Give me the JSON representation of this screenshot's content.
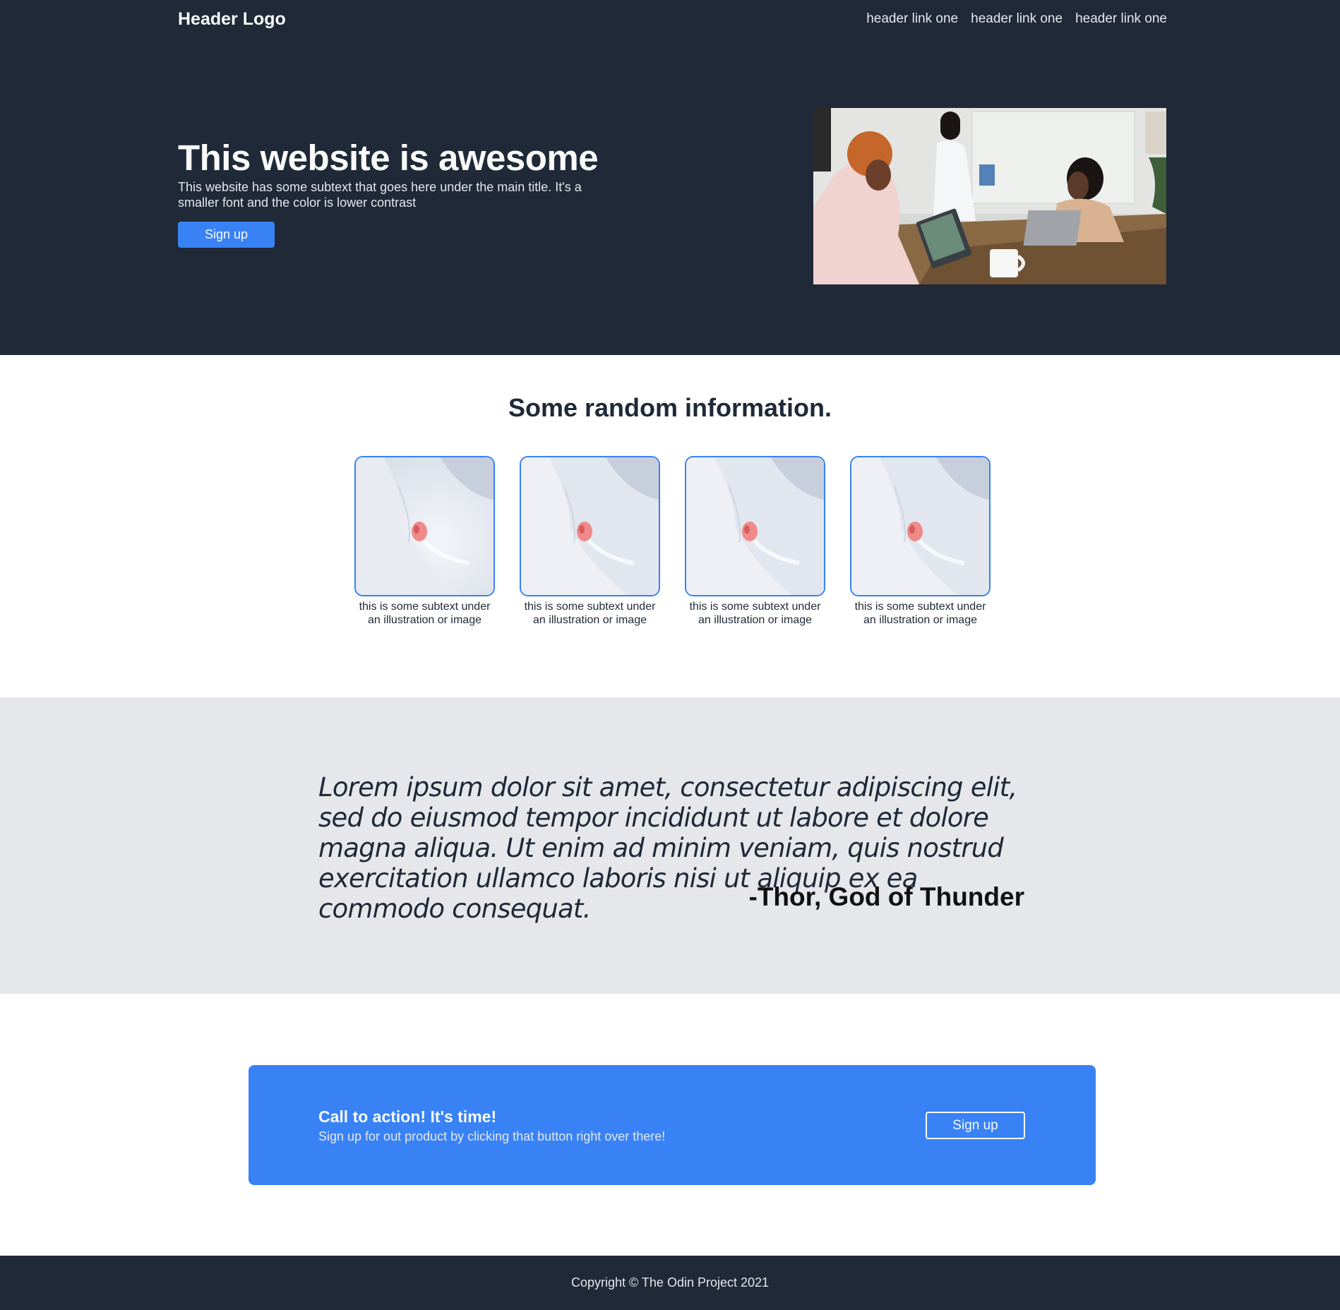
{
  "header": {
    "logo": "Header Logo",
    "links": [
      "header link one",
      "header link one",
      "header link one"
    ]
  },
  "hero": {
    "title": "This website is awesome",
    "subtext": "This website has some subtext that goes here under the main title. It's a smaller font and the color is lower contrast",
    "button_label": "Sign up"
  },
  "info": {
    "title": "Some random information.",
    "cards": [
      {
        "caption": "this is some subtext under an illustration or image"
      },
      {
        "caption": "this is some subtext under an illustration or image"
      },
      {
        "caption": "this is some subtext under an illustration or image"
      },
      {
        "caption": "this is some subtext under an illustration or image"
      }
    ]
  },
  "quote": {
    "text": "Lorem ipsum dolor sit amet, consectetur adipiscing elit, sed do eiusmod tempor incididunt ut labore et dolore magna aliqua. Ut enim ad minim veniam, quis nostrud exercitation ullamco laboris nisi ut aliquip ex ea commodo consequat.",
    "author": "-Thor, God of Thunder"
  },
  "cta": {
    "title": "Call to action! It's time!",
    "subtext": "Sign up for out product by clicking that button right over there!",
    "button_label": "Sign up"
  },
  "footer": {
    "copyright": "Copyright © The Odin Project 2021"
  },
  "colors": {
    "dark": "#1f2937",
    "accent": "#3882f6",
    "light_gray": "#e5e7eb",
    "white": "#f9faf8"
  }
}
